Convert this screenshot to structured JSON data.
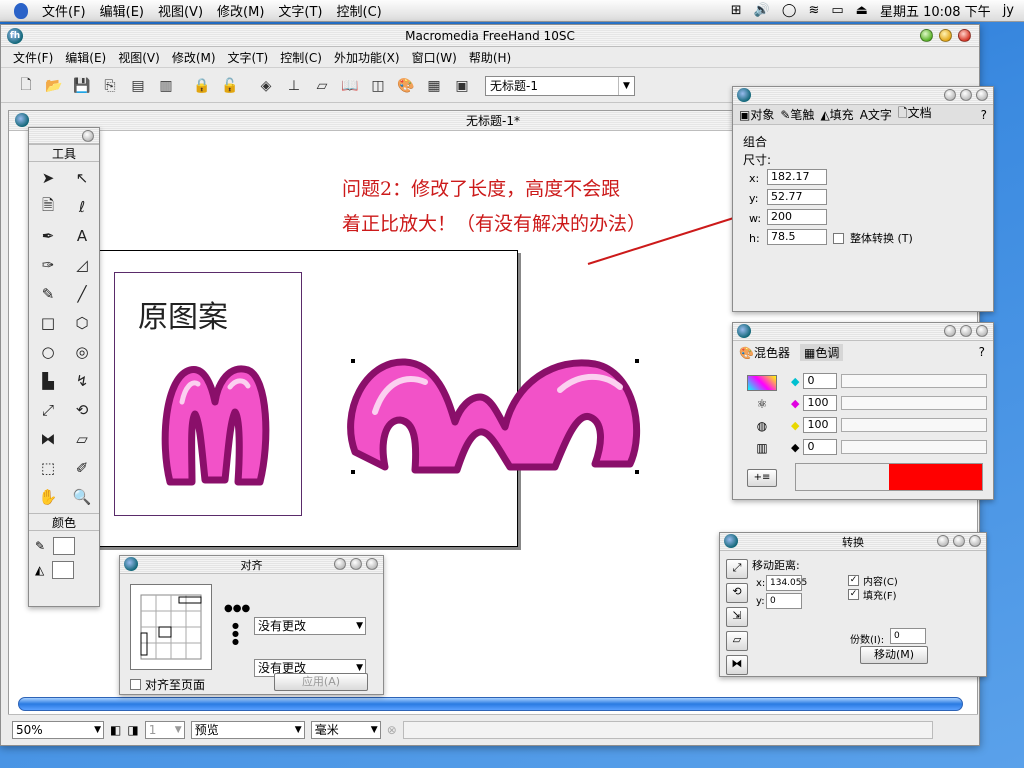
{
  "menubar": {
    "items": [
      "文件(F)",
      "编辑(E)",
      "视图(V)",
      "修改(M)",
      "文字(T)",
      "控制(C)"
    ],
    "clock": "星期五 10:08 下午",
    "user": "jy"
  },
  "app": {
    "title": "Macromedia FreeHand 10SC",
    "menus": [
      "文件(F)",
      "编辑(E)",
      "视图(V)",
      "修改(M)",
      "文字(T)",
      "控制(C)",
      "外加功能(X)",
      "窗口(W)",
      "帮助(H)"
    ],
    "doc_select": "无标题-1"
  },
  "document": {
    "title": "无标题-1*",
    "orig_label": "原图案",
    "question_line1": "问题2：修改了长度，高度不会跟",
    "question_line2": "着正比放大！（有没有解决的办法）"
  },
  "tools": {
    "header": "工具",
    "color_header": "颜色"
  },
  "object_panel": {
    "tabs": [
      "对象",
      "笔触",
      "填充",
      "文字",
      "文档"
    ],
    "group_label": "组合",
    "size_label": "尺寸:",
    "x_label": "x:",
    "x": "182.17",
    "y_label": "y:",
    "y": "52.77",
    "w_label": "w:",
    "w": "200",
    "h_label": "h:",
    "h": "78.5",
    "transform_label": "整体转换 (T)"
  },
  "mixer_panel": {
    "tab1": "混色器",
    "tab2": "色调",
    "c": "0",
    "m": "100",
    "y": "100",
    "k": "0",
    "swatch_colors": [
      "#ffffff",
      "#ff0000"
    ]
  },
  "transform_panel": {
    "title": "转换",
    "move_label": "移动距离:",
    "x_label": "x:",
    "x": "134.055",
    "y_label": "y:",
    "y": "0",
    "content_label": "内容(C)",
    "fill_label": "填充(F)",
    "copies_label": "份数(I):",
    "copies": "0",
    "move_button": "移动(M)"
  },
  "align_panel": {
    "title": "对齐",
    "h_option": "没有更改",
    "v_option": "没有更改",
    "page_label": "对齐至页面",
    "apply_button": "应用(A)"
  },
  "statusbar": {
    "zoom": "50%",
    "page": "1",
    "view_mode": "预览",
    "units": "毫米"
  },
  "colors": {
    "shape_fill": "#f252c8",
    "shape_outline": "#8a0f6a",
    "question_text": "#cc1a1a"
  }
}
